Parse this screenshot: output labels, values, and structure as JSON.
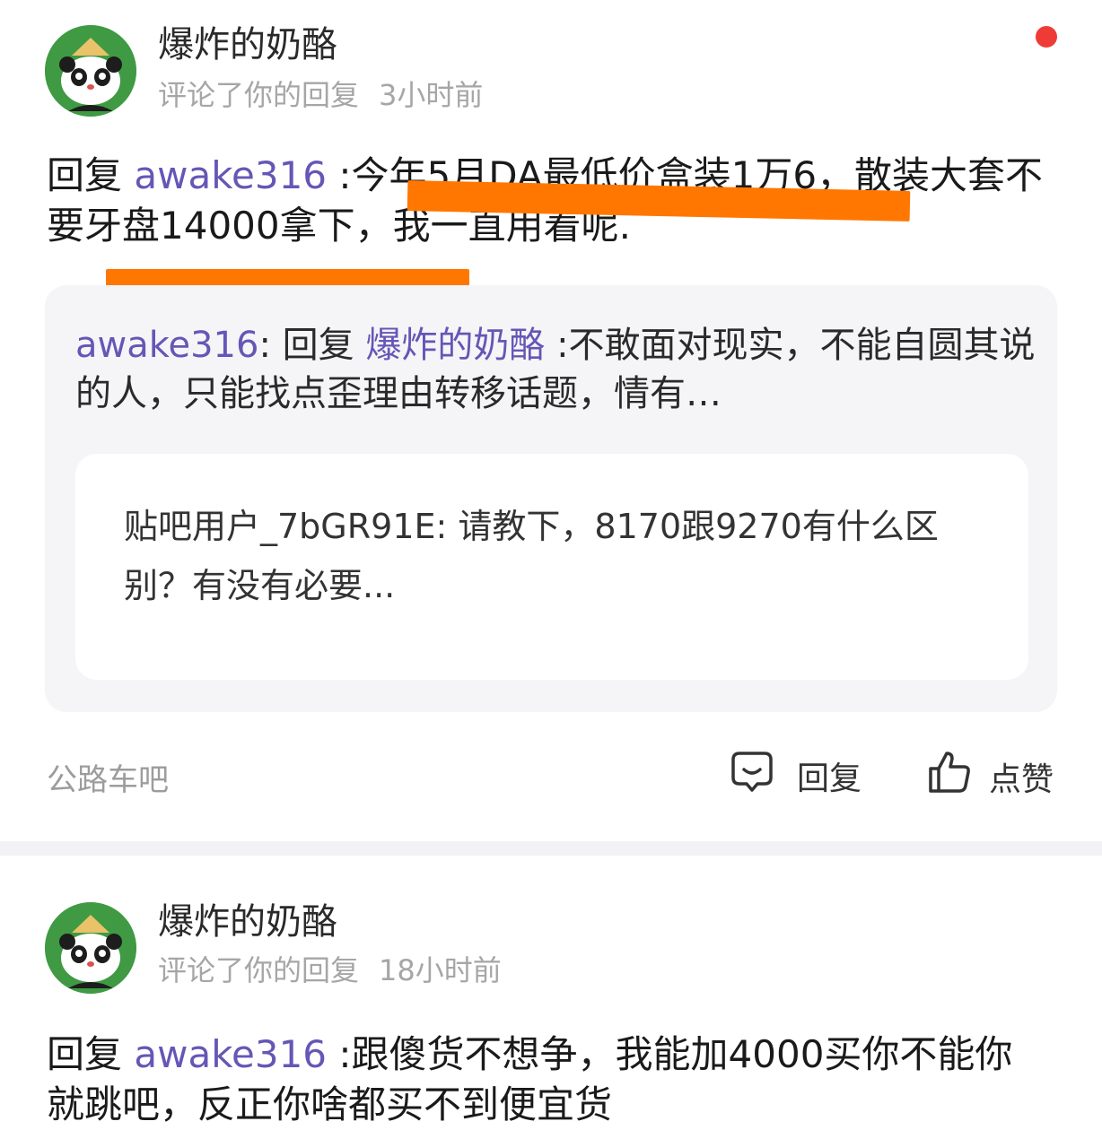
{
  "notifications": [
    {
      "username": "爆炸的奶酪",
      "action_text": "评论了你的回复",
      "time": "3小时前",
      "unread_dot_color": "#ef3b36",
      "reply_prefix": "回复",
      "mention": "awake316",
      "reply_body": ":今年5月DA最低价盒装1万6，散装大套不要牙盘14000拿下，我一直用着呢.",
      "quote": {
        "author": "awake316",
        "colon": ":",
        "prefix": "回复",
        "mention": "爆炸的奶酪",
        "body": ":不敢面对现实，不能自圆其说的人，只能找点歪理由转移话题，情有…",
        "inner": {
          "author": "贴吧用户_7bGR91E",
          "colon": ":",
          "body": "请教下，8170跟9270有什么区别？有没有必要..."
        }
      },
      "forum": "公路车吧",
      "reply_button": "回复",
      "like_button": "点赞"
    },
    {
      "username": "爆炸的奶酪",
      "action_text": "评论了你的回复",
      "time": "18小时前",
      "reply_prefix": "回复",
      "mention": "awake316",
      "reply_body": ":跟傻货不想争，我能加4000买你不能你就跳吧，反正你啥都买不到便宜货"
    }
  ],
  "colors": {
    "mention": "#6656b6",
    "highlight_marker": "#ff7700",
    "avatar_bg": "#3f9a43"
  },
  "icons": {
    "reply": "comment-bubble-icon",
    "like": "thumbs-up-icon"
  }
}
